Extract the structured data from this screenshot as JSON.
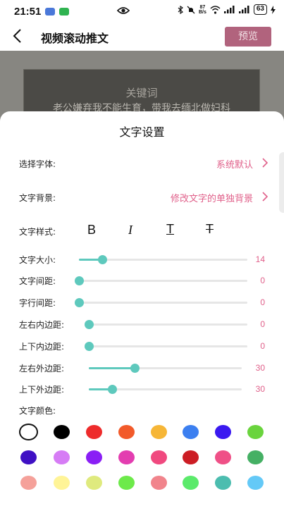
{
  "status": {
    "time": "21:51",
    "speed_top": "87",
    "speed_unit": "B/s",
    "battery": "63"
  },
  "header": {
    "title": "视频滚动推文",
    "preview_label": "预览"
  },
  "background": {
    "keyword": "关键词",
    "text": "老公嫌弃我不能生育，带我去缅北做妇科"
  },
  "panel": {
    "title": "文字设置",
    "font": {
      "label": "选择字体:",
      "value": "系统默认"
    },
    "text_bg": {
      "label": "文字背景:",
      "value": "修改文字的单独背景"
    },
    "text_style": {
      "label": "文字样式:",
      "bold": "B",
      "italic": "I",
      "underline": "T",
      "strike": "T"
    },
    "sliders": [
      {
        "label": "文字大小:",
        "value": "14",
        "fraction": 0.14
      },
      {
        "label": "文字间距:",
        "value": "0",
        "fraction": 0.0
      },
      {
        "label": "字行间距:",
        "value": "0",
        "fraction": 0.0
      },
      {
        "label": "左右内边距:",
        "value": "0",
        "fraction": 0.0
      },
      {
        "label": "上下内边距:",
        "value": "0",
        "fraction": 0.0
      },
      {
        "label": "左右外边距:",
        "value": "30",
        "fraction": 0.3
      },
      {
        "label": "上下外边距:",
        "value": "30",
        "fraction": 0.15
      }
    ],
    "color_label": "文字颜色:",
    "colors": [
      "#ffffff",
      "#000000",
      "#ee2b2b",
      "#f25a2a",
      "#f6b637",
      "#3c7ff0",
      "#3a19f0",
      "#6ad43d",
      "#3f10c4",
      "#d67cf5",
      "#8a1ff5",
      "#e33db0",
      "#f0497f",
      "#cc1d24",
      "#ef5087",
      "#45b064",
      "#f5a19a",
      "#fff497",
      "#dfea7e",
      "#6dea4a",
      "#f1848c",
      "#5bea6b",
      "#4cbdaf",
      "#64c9f7"
    ],
    "selected_color": "#ffffff"
  },
  "accent": "#e0608a",
  "slider_color": "#5ec9bd"
}
